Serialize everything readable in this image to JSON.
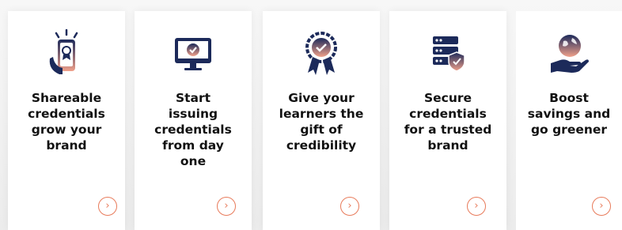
{
  "cards": [
    {
      "title_lines": [
        "Shareable",
        "credentials",
        "grow your",
        "brand"
      ],
      "icon": "phone-certificate-icon",
      "arrow": "›"
    },
    {
      "title_lines": [
        "Start",
        "issuing",
        "credentials",
        "from day",
        "one"
      ],
      "icon": "monitor-check-icon",
      "arrow": "›"
    },
    {
      "title_lines": [
        "Give your",
        "learners the",
        "gift of",
        "credibility"
      ],
      "icon": "award-ribbon-icon",
      "arrow": "›"
    },
    {
      "title_lines": [
        "Secure",
        "credentials",
        "for a trusted",
        "brand"
      ],
      "icon": "server-shield-icon",
      "arrow": "›"
    },
    {
      "title_lines": [
        "Boost",
        "savings and",
        "go greener"
      ],
      "icon": "hand-globe-icon",
      "arrow": "›"
    }
  ],
  "colors": {
    "navy": "#1c2a5a",
    "accent": "#e87b5b",
    "gradient_end": "#f0a08a"
  }
}
